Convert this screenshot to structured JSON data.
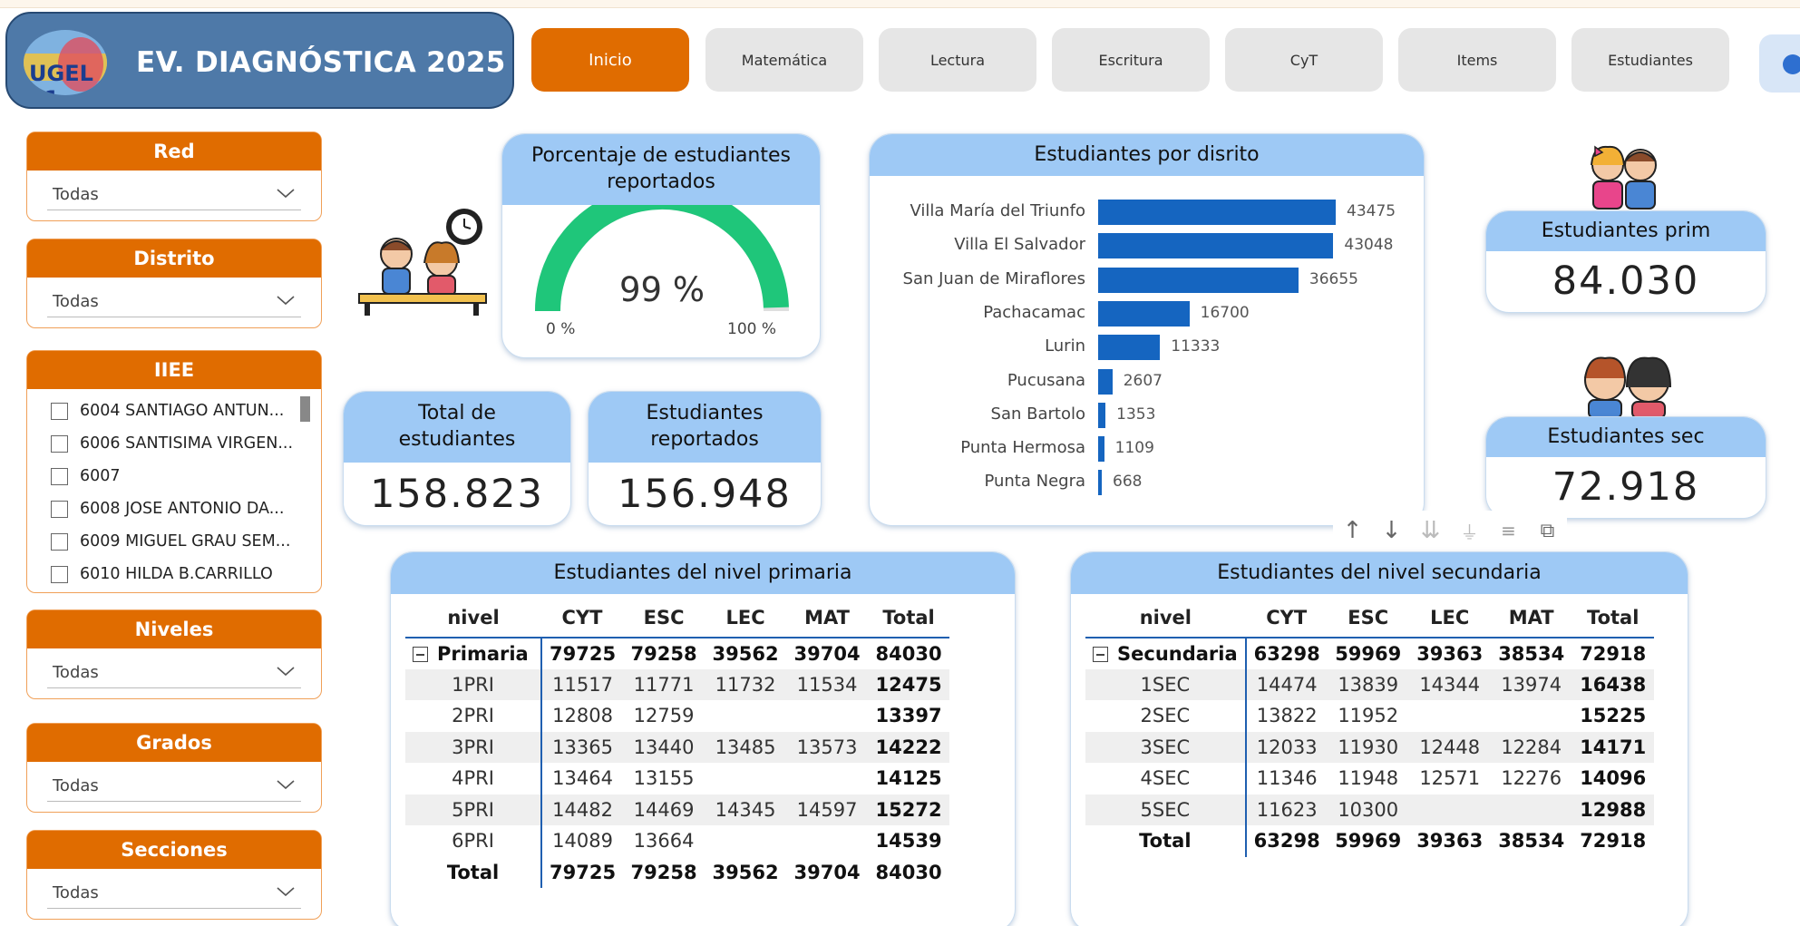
{
  "header": {
    "logo_text": "UGEL 01",
    "title": "EV. DIAGNÓSTICA 2025"
  },
  "nav": {
    "tabs": [
      {
        "label": "Inicio",
        "active": true
      },
      {
        "label": "Matemática"
      },
      {
        "label": "Lectura"
      },
      {
        "label": "Escritura"
      },
      {
        "label": "CyT"
      },
      {
        "label": "Items"
      },
      {
        "label": "Estudiantes"
      }
    ]
  },
  "slicers": {
    "red": {
      "title": "Red",
      "value": "Todas"
    },
    "distrito": {
      "title": "Distrito",
      "value": "Todas"
    },
    "iiee": {
      "title": "IIEE",
      "items": [
        "6004 SANTIAGO ANTUN...",
        "6006 SANTISIMA VIRGEN...",
        "6007",
        "6008 JOSE ANTONIO DA...",
        "6009 MIGUEL GRAU SEM...",
        "6010 HILDA B.CARRILLO"
      ]
    },
    "niveles": {
      "title": "Niveles",
      "value": "Todas"
    },
    "grados": {
      "title": "Grados",
      "value": "Todas"
    },
    "secciones": {
      "title": "Secciones",
      "value": "Todas"
    }
  },
  "gauge": {
    "title": "Porcentaje de estudiantes reportados",
    "value_label": "99 %",
    "value": 0.99,
    "min_label": "0 %",
    "max_label": "100 %",
    "color": "#1fc67a"
  },
  "kpis": {
    "total": {
      "title": "Total de estudiantes",
      "value": "158.823"
    },
    "reportados": {
      "title": "Estudiantes reportados",
      "value": "156.948"
    },
    "prim": {
      "title": "Estudiantes prim",
      "value": "84.030"
    },
    "sec": {
      "title": "Estudiantes sec",
      "value": "72.918"
    }
  },
  "chart_data": {
    "type": "bar",
    "orientation": "horizontal",
    "title": "Estudiantes por disrito",
    "categories": [
      "Villa María del Triunfo",
      "Villa El Salvador",
      "San Juan de Miraflores",
      "Pachacamac",
      "Lurin",
      "Pucusana",
      "San Bartolo",
      "Punta Hermosa",
      "Punta Negra"
    ],
    "values": [
      43475,
      43048,
      36655,
      16700,
      11333,
      2607,
      1353,
      1109,
      668
    ],
    "color": "#1565c0"
  },
  "tables": {
    "primaria": {
      "title": "Estudiantes del nivel primaria",
      "headers": [
        "nivel",
        "CYT",
        "ESC",
        "LEC",
        "MAT",
        "Total"
      ],
      "group": [
        "Primaria",
        "79725",
        "79258",
        "39562",
        "39704",
        "84030"
      ],
      "rows": [
        [
          "1PRI",
          "11517",
          "11771",
          "11732",
          "11534",
          "12475"
        ],
        [
          "2PRI",
          "12808",
          "12759",
          "",
          "",
          "13397"
        ],
        [
          "3PRI",
          "13365",
          "13440",
          "13485",
          "13573",
          "14222"
        ],
        [
          "4PRI",
          "13464",
          "13155",
          "",
          "",
          "14125"
        ],
        [
          "5PRI",
          "14482",
          "14469",
          "14345",
          "14597",
          "15272"
        ],
        [
          "6PRI",
          "14089",
          "13664",
          "",
          "",
          "14539"
        ]
      ],
      "total": [
        "Total",
        "79725",
        "79258",
        "39562",
        "39704",
        "84030"
      ]
    },
    "secundaria": {
      "title": "Estudiantes del nivel secundaria",
      "headers": [
        "nivel",
        "CYT",
        "ESC",
        "LEC",
        "MAT",
        "Total"
      ],
      "group": [
        "Secundaria",
        "63298",
        "59969",
        "39363",
        "38534",
        "72918"
      ],
      "rows": [
        [
          "1SEC",
          "14474",
          "13839",
          "14344",
          "13974",
          "16438"
        ],
        [
          "2SEC",
          "13822",
          "11952",
          "",
          "",
          "15225"
        ],
        [
          "3SEC",
          "12033",
          "11930",
          "12448",
          "12284",
          "14171"
        ],
        [
          "4SEC",
          "11346",
          "11948",
          "12571",
          "12276",
          "14096"
        ],
        [
          "5SEC",
          "11623",
          "10300",
          "",
          "",
          "12988"
        ]
      ],
      "total": [
        "Total",
        "63298",
        "59969",
        "39363",
        "38534",
        "72918"
      ]
    }
  },
  "toolbar": {
    "icons": [
      "arrow-up-icon",
      "arrow-down-icon",
      "double-arrow-down-icon",
      "expand-hierarchy-icon",
      "filter-icon",
      "focus-mode-icon"
    ]
  }
}
